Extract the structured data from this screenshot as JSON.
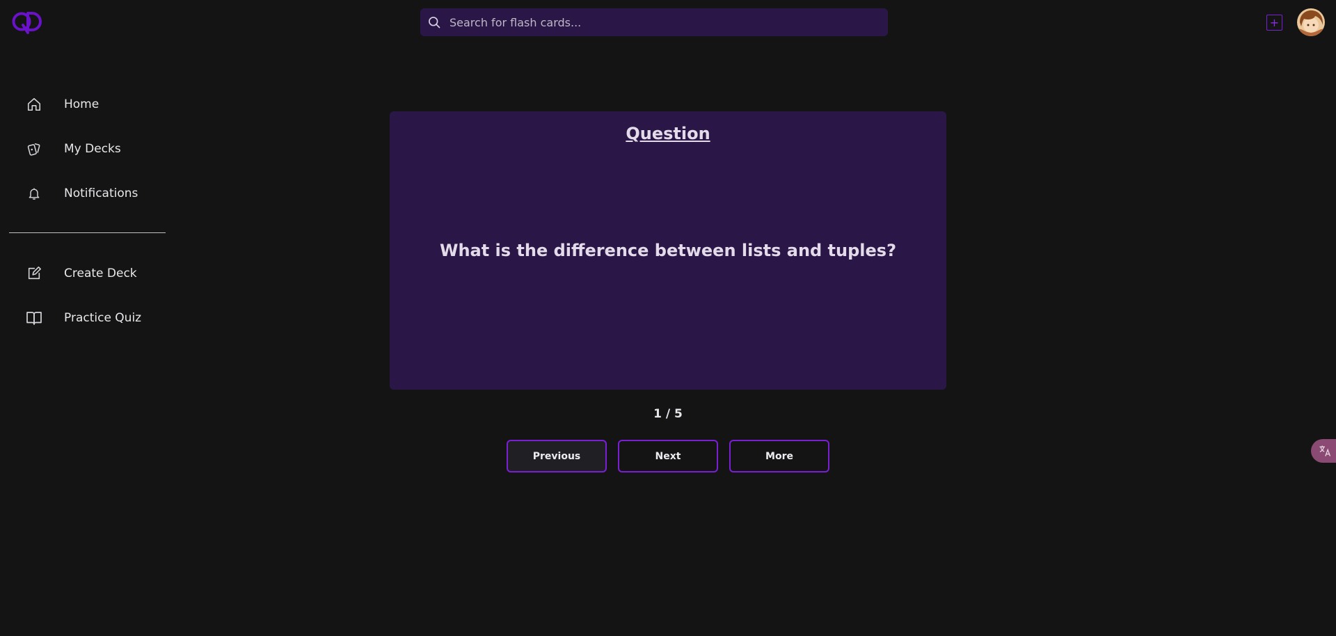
{
  "header": {
    "logo_text": "QD",
    "search": {
      "placeholder": "Search for flash cards...",
      "value": ""
    },
    "add_button_label": "+"
  },
  "sidebar": {
    "items": [
      {
        "label": "Home",
        "icon": "home-icon"
      },
      {
        "label": "My Decks",
        "icon": "cards-icon"
      },
      {
        "label": "Notifications",
        "icon": "bell-icon"
      }
    ],
    "secondary_items": [
      {
        "label": "Create Deck",
        "icon": "edit-icon"
      },
      {
        "label": "Practice Quiz",
        "icon": "book-icon"
      }
    ]
  },
  "card": {
    "heading": "Question",
    "text": "What is the difference between lists and tuples?"
  },
  "pagination": {
    "text": "1 / 5",
    "current": 1,
    "total": 5
  },
  "controls": {
    "previous": "Previous",
    "next": "Next",
    "more": "More"
  },
  "colors": {
    "background": "#141414",
    "card": "#2b1747",
    "accent": "#7b1fd6",
    "text": "#e6e6ea"
  }
}
